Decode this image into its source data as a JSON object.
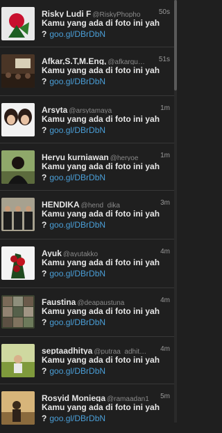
{
  "tweets": [
    {
      "name": "Risky Ludi F",
      "handle": "@RiskyPhopho",
      "time": "50s",
      "text": "Kamu yang ada di foto ini yah ?",
      "link": "goo.gl/DBrDbN",
      "avatar": "avatar-photo-red-plant"
    },
    {
      "name": "Afkar,S.T,M.Eng,",
      "handle": "@afkargu…",
      "time": "51s",
      "text": "Kamu yang ada di foto ini yah ?",
      "link": "goo.gl/DBrDbN",
      "avatar": "avatar-photo-classroom"
    },
    {
      "name": "Arsyta",
      "handle": "@arsytamaya",
      "time": "1m",
      "text": "Kamu yang ada di foto ini yah ?",
      "link": "goo.gl/DBrDbN",
      "avatar": "avatar-photo-two-girls"
    },
    {
      "name": "Heryu kurniawan",
      "handle": "@heryoe",
      "time": "1m",
      "text": "Kamu yang ada di foto ini yah ?",
      "link": "goo.gl/DBrDbN",
      "avatar": "avatar-photo-man-outdoor"
    },
    {
      "name": "HENDIKA",
      "handle": "@hend_dika",
      "time": "3m",
      "text": "Kamu yang ada di foto ini yah ?",
      "link": "goo.gl/DBrDbN",
      "avatar": "avatar-photo-group-suits"
    },
    {
      "name": "Ayuk",
      "handle": "@ayutakko",
      "time": "4m",
      "text": "Kamu yang ada di foto ini yah ?",
      "link": "goo.gl/DBrDbN",
      "avatar": "avatar-photo-red-flowers"
    },
    {
      "name": "Faustina",
      "handle": "@deapaustuna",
      "time": "4m",
      "text": "Kamu yang ada di foto ini yah ?",
      "link": "goo.gl/DBrDbN",
      "avatar": "avatar-photo-collage"
    },
    {
      "name": "septaadhitya",
      "handle": "@putraa_adhit…",
      "time": "4m",
      "text": "Kamu yang ada di foto ini yah ?",
      "link": "goo.gl/DBrDbN",
      "avatar": "avatar-photo-field"
    },
    {
      "name": "Rosyid Moniega",
      "handle": "@ramaadan1",
      "time": "5m",
      "text": "Kamu yang ada di foto ini yah ?",
      "link": "goo.gl/DBrDbN",
      "avatar": "avatar-photo-sunset"
    }
  ]
}
